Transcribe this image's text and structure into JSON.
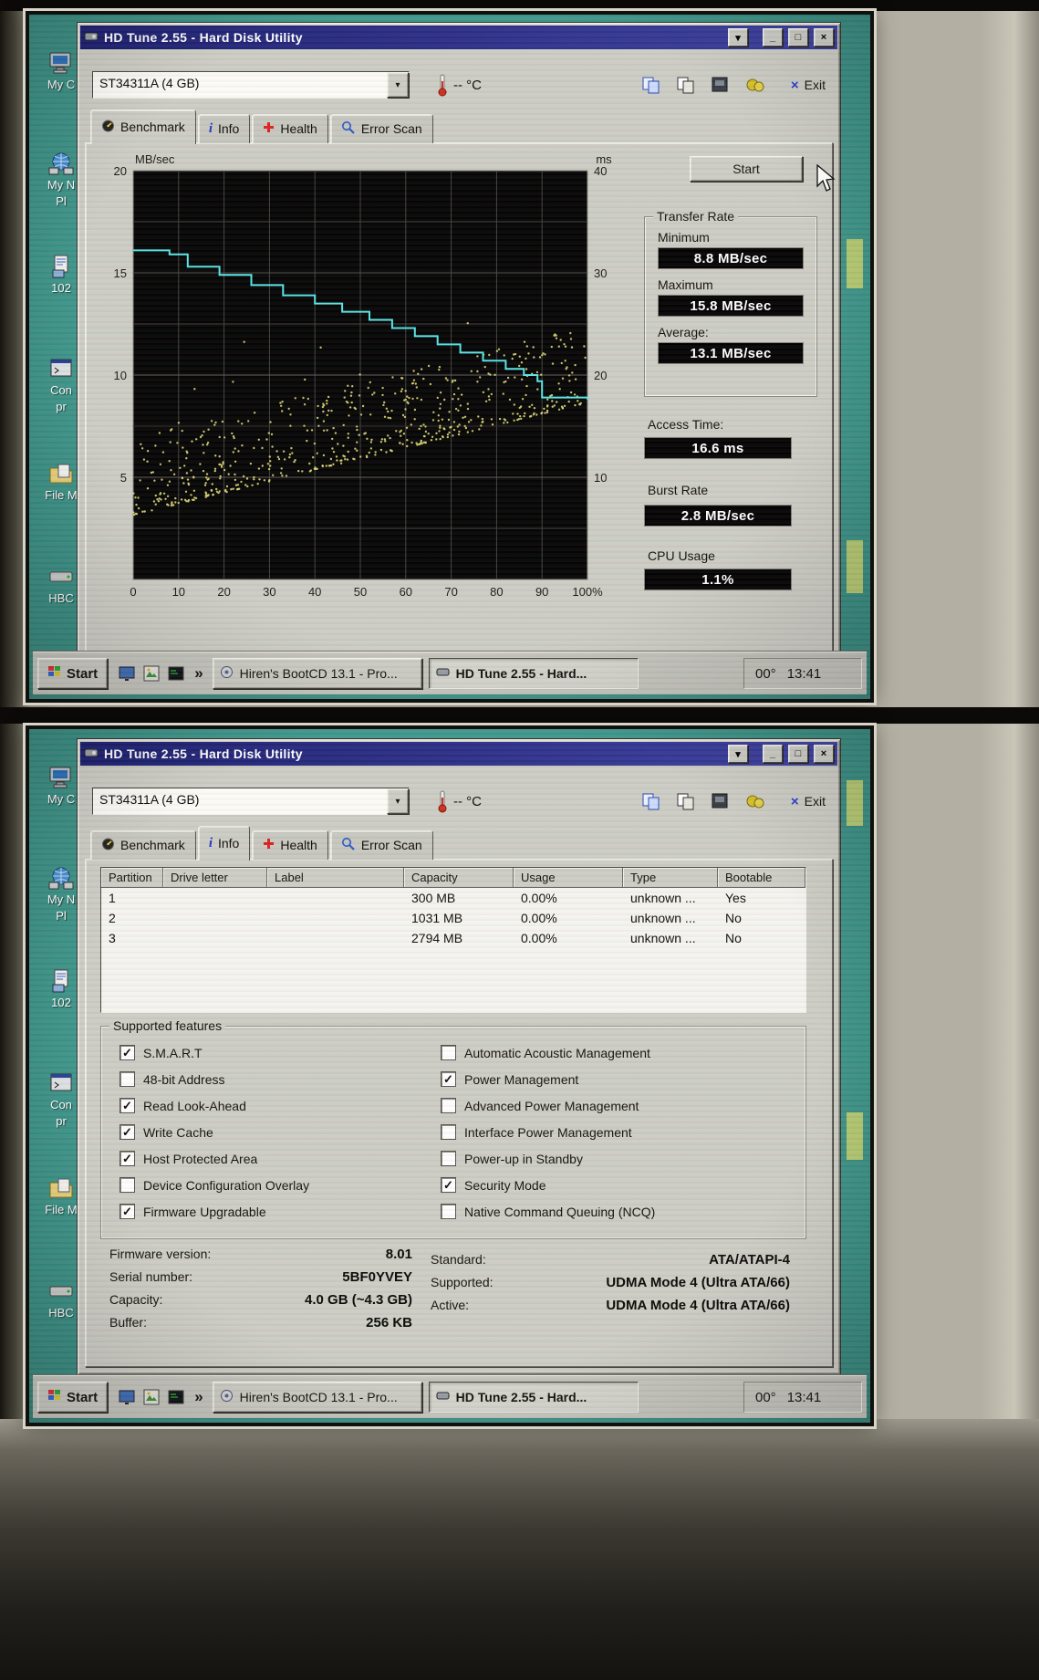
{
  "theme": {
    "titlebar_color": "#1d2070",
    "desktop_color": "#40988c",
    "window_face_color": "#cdcec6"
  },
  "app": {
    "title": "HD Tune 2.55 - Hard Disk Utility",
    "drive_selector": "ST34311A (4 GB)",
    "temperature": "-- °C",
    "exit_label": "Exit",
    "tabs": [
      "Benchmark",
      "Info",
      "Health",
      "Error Scan"
    ]
  },
  "benchmark": {
    "start_button": "Start",
    "results": {
      "transfer_rate_label": "Transfer Rate",
      "minimum_label": "Minimum",
      "minimum_value": "8.8 MB/sec",
      "maximum_label": "Maximum",
      "maximum_value": "15.8 MB/sec",
      "average_label": "Average:",
      "average_value": "13.1 MB/sec",
      "access_time_label": "Access Time:",
      "access_time_value": "16.6 ms",
      "burst_rate_label": "Burst Rate",
      "burst_rate_value": "2.8 MB/sec",
      "cpu_usage_label": "CPU Usage",
      "cpu_usage_value": "1.1%"
    },
    "chart_data": {
      "type": "line",
      "x_axis": {
        "range": [
          0,
          100
        ],
        "tick_labels": [
          "0",
          "10",
          "20",
          "30",
          "40",
          "50",
          "60",
          "70",
          "80",
          "90",
          "100%"
        ]
      },
      "left_axis": {
        "label": "MB/sec",
        "range": [
          0,
          20
        ],
        "ticks": [
          20,
          15,
          10,
          5
        ]
      },
      "right_axis": {
        "label": "ms",
        "range": [
          0,
          40
        ],
        "ticks": [
          40,
          30,
          20,
          10
        ]
      },
      "grid": true,
      "transfer_rate_line": {
        "x": [
          0,
          8,
          12,
          19,
          26,
          33,
          40,
          46,
          52,
          57,
          62,
          67,
          72,
          77,
          82,
          86,
          89,
          90,
          100
        ],
        "mb_per_sec": [
          16.1,
          15.9,
          15.3,
          14.9,
          14.4,
          13.9,
          13.5,
          13.1,
          12.7,
          12.3,
          11.9,
          11.5,
          11.1,
          10.7,
          10.3,
          10.0,
          9.7,
          8.9,
          8.8
        ]
      },
      "access_time_scatter": {
        "unit": "ms",
        "count": 620,
        "seed": 11,
        "ms_base": 7.5,
        "ms_slope": 0.11,
        "ms_spread": 7.5
      },
      "colors": {
        "line": "#59e8e8",
        "scatter": "#ded878",
        "plot_bg": "#060606"
      }
    }
  },
  "info": {
    "columns": [
      "Partition",
      "Drive letter",
      "Label",
      "Capacity",
      "Usage",
      "Type",
      "Bootable"
    ],
    "partitions": [
      {
        "partition": "1",
        "drive_letter": "",
        "label": "",
        "capacity": "300 MB",
        "usage": "0.00%",
        "type": "unknown ...",
        "bootable": "Yes"
      },
      {
        "partition": "2",
        "drive_letter": "",
        "label": "",
        "capacity": "1031 MB",
        "usage": "0.00%",
        "type": "unknown ...",
        "bootable": "No"
      },
      {
        "partition": "3",
        "drive_letter": "",
        "label": "",
        "capacity": "2794 MB",
        "usage": "0.00%",
        "type": "unknown ...",
        "bootable": "No"
      }
    ],
    "features_group_label": "Supported features",
    "features_left": [
      {
        "label": "S.M.A.R.T",
        "checked": true
      },
      {
        "label": "48-bit Address",
        "checked": false
      },
      {
        "label": "Read Look-Ahead",
        "checked": true
      },
      {
        "label": "Write Cache",
        "checked": true
      },
      {
        "label": "Host Protected Area",
        "checked": true
      },
      {
        "label": "Device Configuration Overlay",
        "checked": false
      },
      {
        "label": "Firmware Upgradable",
        "checked": true
      }
    ],
    "features_right": [
      {
        "label": "Automatic Acoustic Management",
        "checked": false
      },
      {
        "label": "Power Management",
        "checked": true
      },
      {
        "label": "Advanced Power Management",
        "checked": false
      },
      {
        "label": "Interface Power Management",
        "checked": false
      },
      {
        "label": "Power-up in Standby",
        "checked": false
      },
      {
        "label": "Security Mode",
        "checked": true
      },
      {
        "label": "Native Command Queuing (NCQ)",
        "checked": false
      }
    ],
    "details_left": [
      {
        "label": "Firmware version:",
        "value": "8.01"
      },
      {
        "label": "Serial number:",
        "value": "5BF0YVEY"
      },
      {
        "label": "Capacity:",
        "value": "4.0 GB (~4.3 GB)"
      },
      {
        "label": "Buffer:",
        "value": "256 KB"
      }
    ],
    "details_right": [
      {
        "label": "Standard:",
        "value": "ATA/ATAPI-4"
      },
      {
        "label": "Supported:",
        "value": "UDMA Mode 4 (Ultra ATA/66)"
      },
      {
        "label": "Active:",
        "value": "UDMA Mode 4 (Ultra ATA/66)"
      }
    ]
  },
  "desktop": {
    "icons": [
      {
        "label": "My C"
      },
      {
        "label": "My N\nPl"
      },
      {
        "label": "102"
      },
      {
        "label": "Con\npr"
      },
      {
        "label": "File M"
      },
      {
        "label": "HBC"
      }
    ]
  },
  "taskbar": {
    "start_label": "Start",
    "overflow_chevron": "»",
    "tasks": [
      {
        "label": "Hiren's BootCD 13.1 - Pro..."
      },
      {
        "label": "HD Tune 2.55 - Hard..."
      }
    ],
    "tray_temperature": "00°",
    "clock": "13:41"
  }
}
